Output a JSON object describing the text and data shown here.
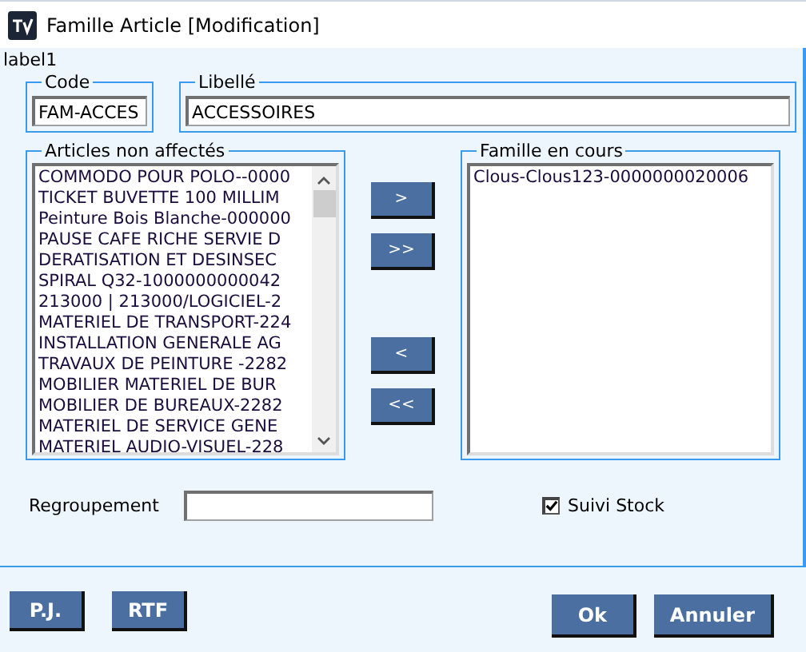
{
  "window": {
    "title": "Famille Article [Modification]"
  },
  "label": "label1",
  "code": {
    "legend": "Code",
    "value": "FAM-ACCES"
  },
  "libelle": {
    "legend": "Libellé",
    "value": "ACCESSOIRES"
  },
  "articles": {
    "legend": "Articles non affectés",
    "items": [
      "COMMODO POUR POLO--0000",
      "TICKET BUVETTE 100 MILLIM",
      "Peinture Bois Blanche-000000",
      "PAUSE CAFE RICHE SERVIE D",
      "DERATISATION ET DESINSEC",
      "SPIRAL Q32-1000000000042",
      "213000 | 213000/LOGICIEL-2",
      "MATERIEL DE TRANSPORT-224",
      "INSTALLATION GENERALE AG",
      "TRAVAUX DE PEINTURE -2282",
      "MOBILIER MATERIEL DE BUR",
      "MOBILIER DE BUREAUX-2282",
      "MATERIEL DE SERVICE GENE",
      "MATERIEL AUDIO-VISUEL-228"
    ]
  },
  "move_buttons": [
    ">",
    ">>",
    "<",
    "<<"
  ],
  "famille": {
    "legend": "Famille en cours",
    "items": [
      "Clous-Clous123-0000000020006"
    ]
  },
  "regroupement": {
    "label": "Regroupement"
  },
  "suivi_stock": {
    "label": "Suivi Stock",
    "checked": true
  },
  "left_buttons": [
    "P.J.",
    "RTF"
  ],
  "right_buttons": [
    "Ok",
    "Annuler"
  ]
}
